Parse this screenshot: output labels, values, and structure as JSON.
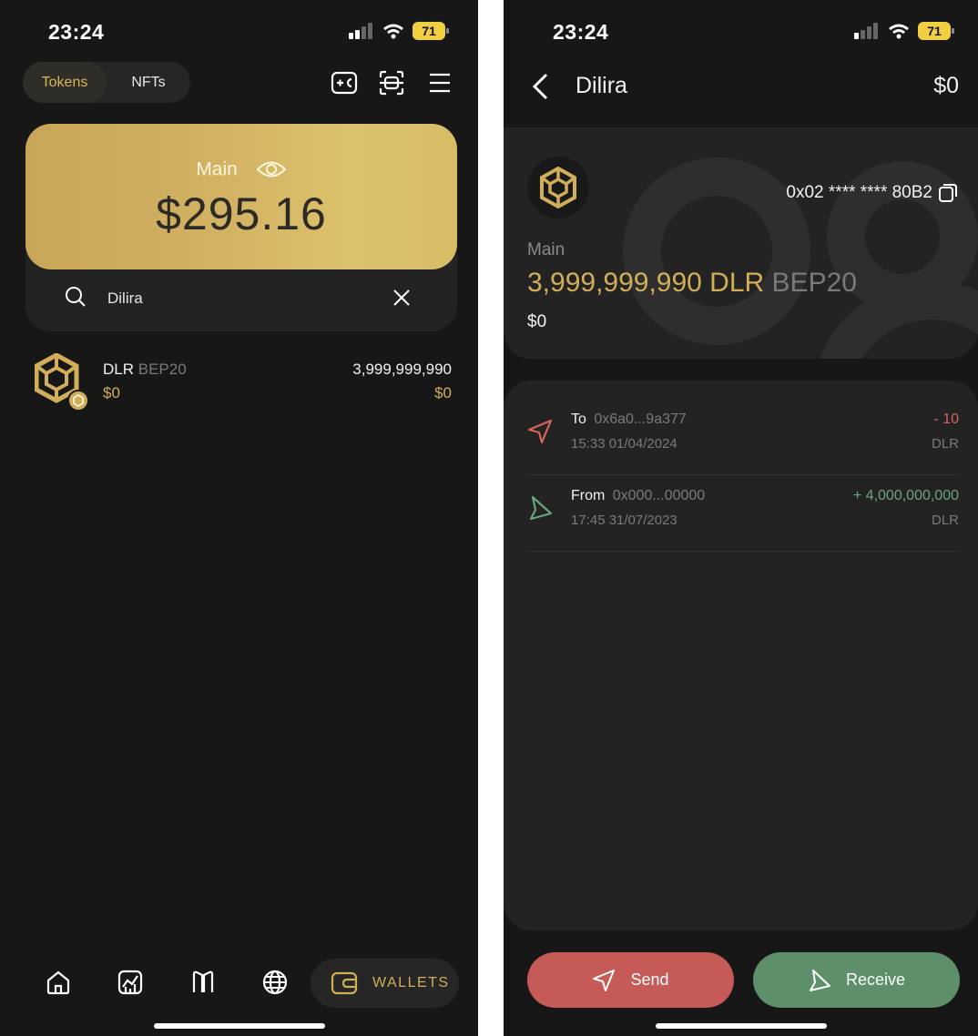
{
  "left": {
    "status": {
      "time": "23:24",
      "battery": "71"
    },
    "tabs": [
      {
        "label": "Tokens"
      },
      {
        "label": "NFTs"
      }
    ],
    "balance": {
      "label": "Main",
      "amount": "$295.16"
    },
    "search": {
      "value": "Dilira"
    },
    "tokens": [
      {
        "symbol": "DLR",
        "network": "BEP20",
        "usd": "$0",
        "amount": "3,999,999,990",
        "amount_usd": "$0"
      }
    ],
    "nav": {
      "wallets_label": "WALLETS"
    },
    "icons": [
      "add-token-icon",
      "scan-icon",
      "menu-icon",
      "search-icon",
      "close-icon",
      "eye-icon",
      "home-icon",
      "market-icon",
      "browser-icon",
      "globe-icon",
      "wallet-icon"
    ]
  },
  "right": {
    "status": {
      "time": "23:24",
      "battery": "71"
    },
    "header": {
      "title": "Dilira",
      "usd": "$0"
    },
    "asset": {
      "address": "0x02 **** **** 80B2",
      "wallet": "Main",
      "amount": "3,999,999,990 DLR",
      "network": "BEP20",
      "usd": "$0"
    },
    "transactions": [
      {
        "direction": "To",
        "address": "0x6a0...9a377",
        "datetime": "15:33 01/04/2024",
        "amount": "- 10",
        "unit": "DLR",
        "color": "#d9625c"
      },
      {
        "direction": "From",
        "address": "0x000...00000",
        "datetime": "17:45 31/07/2023",
        "amount": "+ 4,000,000,000",
        "unit": "DLR",
        "color": "#6aa57a"
      }
    ],
    "actions": {
      "send": "Send",
      "receive": "Receive"
    }
  },
  "colors": {
    "gold": "#d2ae57",
    "send": "#c55a56",
    "receive": "#5e8f6b",
    "background": "#171717"
  }
}
